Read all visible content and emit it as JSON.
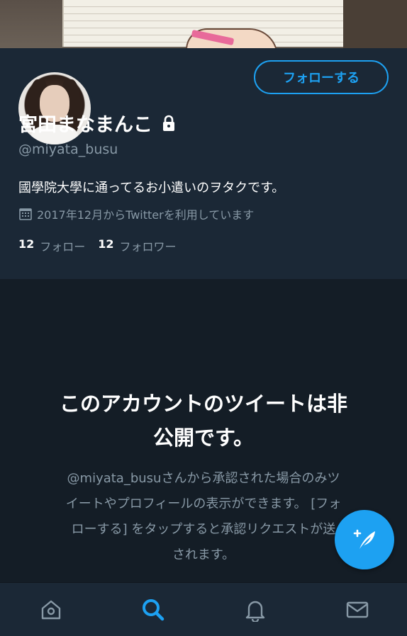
{
  "profile": {
    "display_name": "宮田まなまんこ",
    "handle": "@miyata_busu",
    "bio": "國學院大學に通ってるお小遣いのヲタクです。",
    "joined": "2017年12月からTwitterを利用しています",
    "following_count": "12",
    "following_label": "フォロー",
    "followers_count": "12",
    "followers_label": "フォロワー",
    "follow_button": "フォローする"
  },
  "protected_notice": {
    "title_line1": "このアカウントのツイートは非",
    "title_line2": "公開です。",
    "desc_line1": "@miyata_busuさんから承認された場合のみツ",
    "desc_line2": "イートやプロフィールの表示ができます。 [フォ",
    "desc_line3": "ローする] をタップすると承認リクエストが送",
    "desc_line4": "されます。"
  },
  "colors": {
    "accent": "#1da1f2",
    "background": "#141d26",
    "panel": "#1b2836",
    "secondary_text": "#8899a6"
  },
  "icons": {
    "lock": "lock-icon",
    "calendar": "calendar-icon",
    "compose": "compose-tweet-icon",
    "home": "home-icon",
    "search": "search-icon",
    "notifications": "bell-icon",
    "messages": "mail-icon"
  },
  "tabbar": {
    "active": "search"
  }
}
